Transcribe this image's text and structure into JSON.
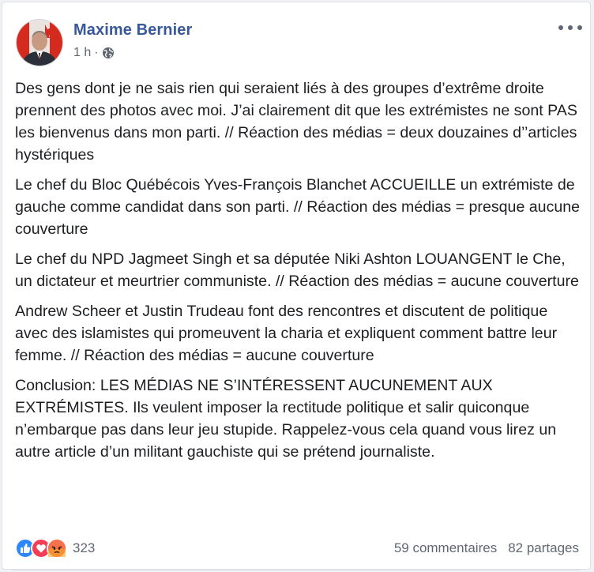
{
  "post": {
    "author": "Maxime Bernier",
    "time": "1 h",
    "separator": "·",
    "privacy_icon": "globe-icon",
    "paragraphs": [
      "Des gens dont je ne sais rien qui seraient liés à des groupes d’extrême droite prennent des photos avec moi. J’ai clairement dit que les extrémistes ne sont PAS les bienvenus dans mon parti. // Réaction des médias = deux douzaines d’’articles hystériques",
      "Le chef du Bloc Québécois Yves-François Blanchet ACCUEILLE un extrémiste de gauche comme candidat dans son parti. // Réaction des médias = presque aucune couverture",
      "Le chef du NPD Jagmeet Singh et sa députée Niki Ashton LOUANGENT le Che, un dictateur et meurtrier communiste. // Réaction des médias = aucune couverture",
      "Andrew Scheer et Justin Trudeau font des rencontres et discutent de politique avec des islamistes qui promeuvent la charia et expliquent comment battre leur femme. // Réaction des médias = aucune couverture",
      "Conclusion: LES MÉDIAS NE S’INTÉRESSENT AUCUNEMENT AUX EXTRÉMISTES. Ils veulent imposer la rectitude politique et salir quiconque n’embarque pas dans leur jeu stupide. Rappelez-vous cela quand vous lirez un autre article d’un militant gauchiste qui se prétend journaliste."
    ]
  },
  "footer": {
    "reaction_icons": [
      "like-icon",
      "love-icon",
      "angry-icon"
    ],
    "reaction_count": "323",
    "comments": "59 commentaires",
    "shares": "82 partages"
  },
  "colors": {
    "author_link": "#385898",
    "meta_text": "#616770",
    "like": "#2d88ff",
    "love": "#f33e58",
    "angry": "#f7714c"
  }
}
